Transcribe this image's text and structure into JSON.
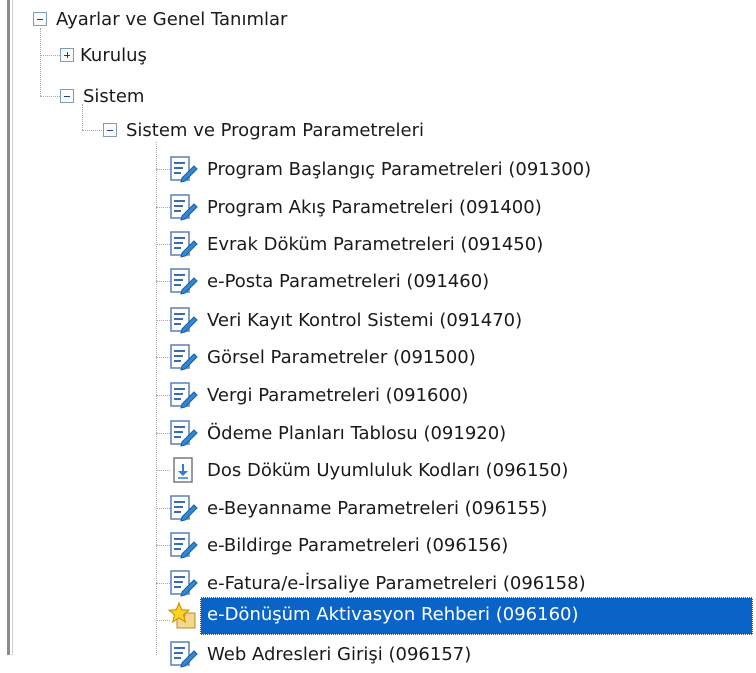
{
  "tree": {
    "root": {
      "label": "Ayarlar ve Genel Tanımlar",
      "expanded": true
    },
    "kurulus": {
      "label": "Kuruluş",
      "expanded": false
    },
    "sistem": {
      "label": "Sistem",
      "expanded": true
    },
    "program_params": {
      "label": "Sistem ve Program Parametreleri",
      "expanded": true
    },
    "items": [
      {
        "label": "Program Başlangıç Parametreleri (091300)",
        "icon": "edit-document-icon"
      },
      {
        "label": "Program Akış Parametreleri (091400)",
        "icon": "edit-document-icon"
      },
      {
        "label": "Evrak Döküm Parametreleri (091450)",
        "icon": "edit-document-icon"
      },
      {
        "label": "e-Posta Parametreleri (091460)",
        "icon": "edit-document-icon"
      },
      {
        "label": "Veri Kayıt Kontrol Sistemi (091470)",
        "icon": "edit-document-icon"
      },
      {
        "label": "Görsel Parametreler (091500)",
        "icon": "edit-document-icon"
      },
      {
        "label": "Vergi Parametreleri (091600)",
        "icon": "edit-document-icon"
      },
      {
        "label": "Ödeme Planları Tablosu (091920)",
        "icon": "edit-document-icon"
      },
      {
        "label": "Dos Döküm Uyumluluk Kodları (096150)",
        "icon": "download-document-icon"
      },
      {
        "label": "e-Beyanname Parametreleri (096155)",
        "icon": "edit-document-icon"
      },
      {
        "label": "e-Bildirge Parametreleri (096156)",
        "icon": "edit-document-icon"
      },
      {
        "label": "e-Fatura/e-İrsaliye Parametreleri (096158)",
        "icon": "edit-document-icon"
      },
      {
        "label": "e-Dönüşüm Aktivasyon Rehberi (096160)",
        "icon": "star-folder-icon",
        "selected": true
      },
      {
        "label": "Web Adresleri Girişi (096157)",
        "icon": "edit-document-icon"
      }
    ]
  },
  "colors": {
    "selection": "#0a64c8",
    "toggle_border": "#7f9db9",
    "tree_line": "#a8a8a8"
  }
}
